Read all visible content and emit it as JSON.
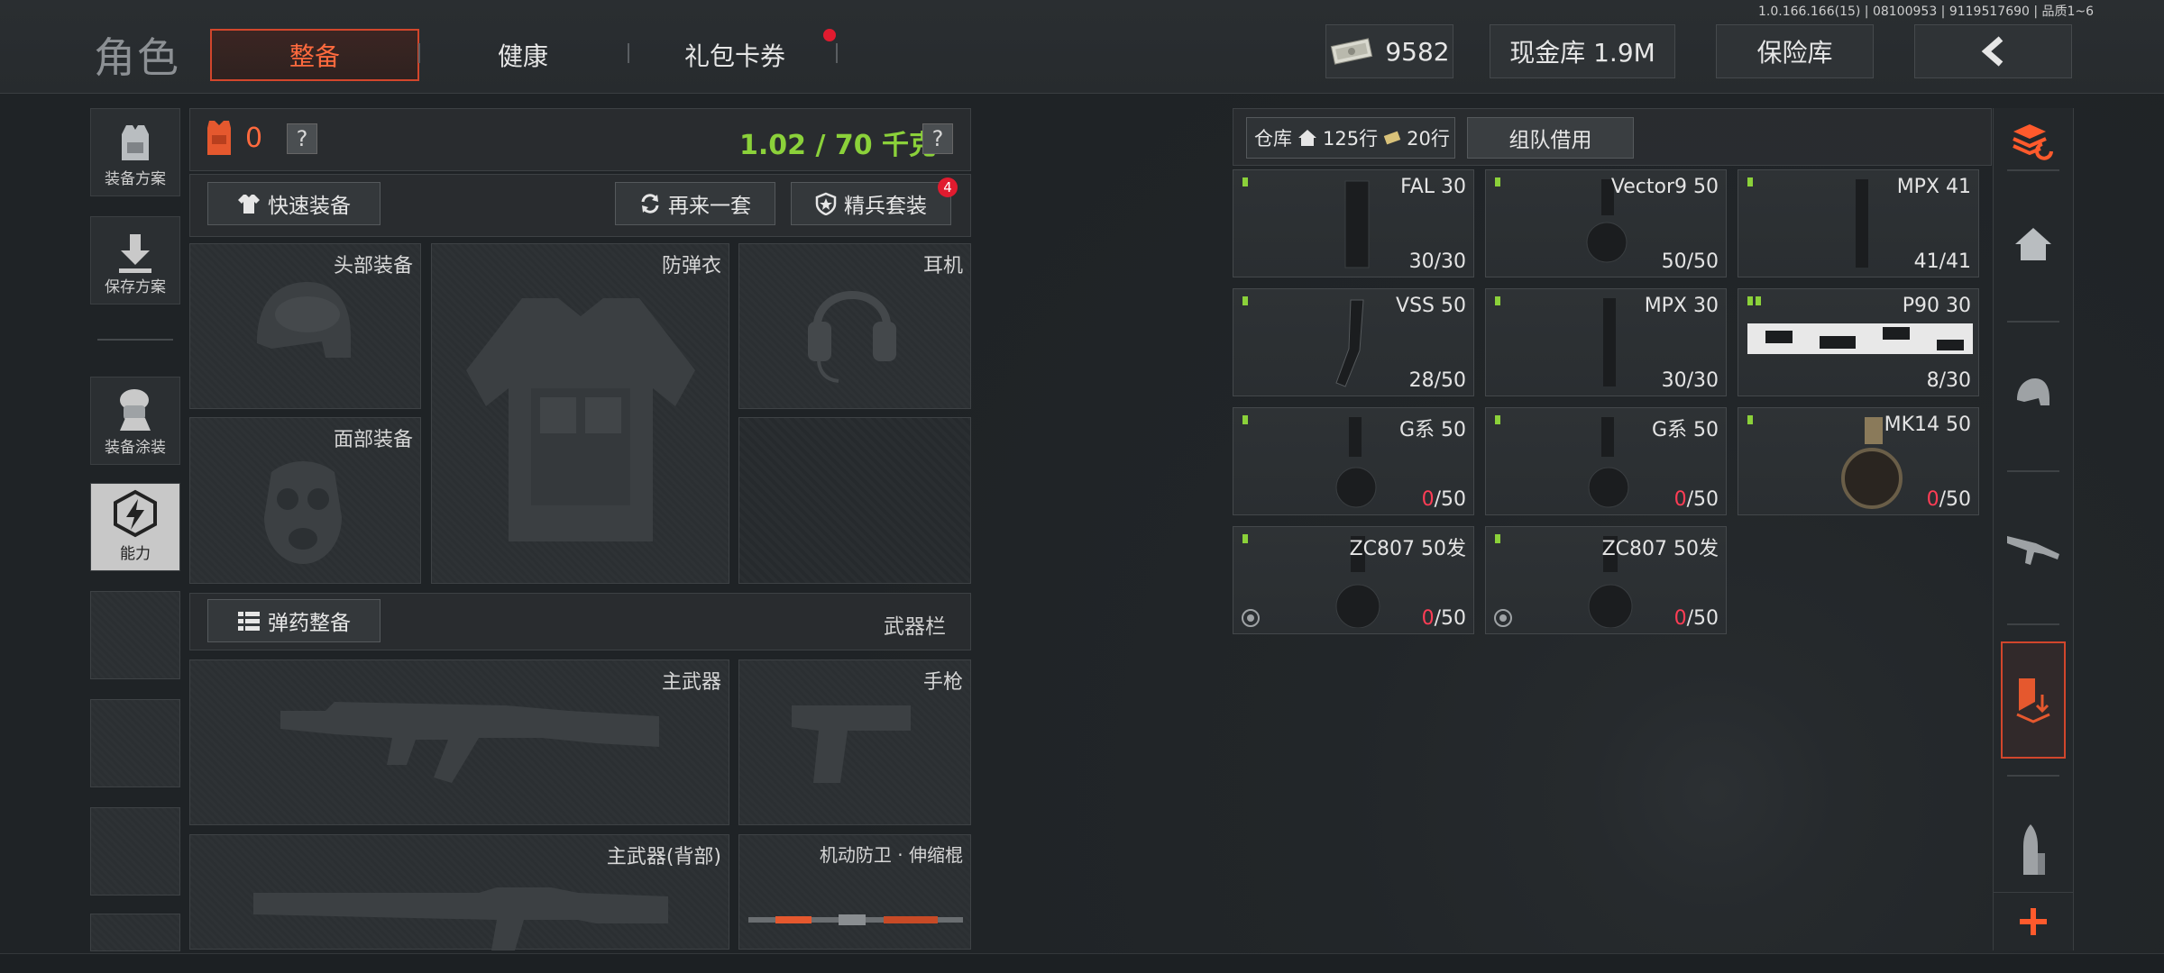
{
  "version_text": "1.0.166.166(15) | 08100953 | 9119517690 | 品质1~6",
  "header": {
    "title": "角色",
    "tabs": [
      {
        "label": "整备",
        "active": true
      },
      {
        "label": "健康",
        "active": false
      },
      {
        "label": "礼包卡券",
        "active": false,
        "has_notification": true
      }
    ],
    "currency": {
      "value": "9582",
      "icon": "banknote-icon"
    },
    "cash_vault_label": "现金库 1.9M",
    "insurance_vault_label": "保险库",
    "back_icon": "chevron-left-icon"
  },
  "left_sidebar": [
    {
      "label": "装备方案",
      "icon": "vest-icon"
    },
    {
      "label": "保存方案",
      "icon": "download-icon"
    },
    {
      "label": "装备涂装",
      "icon": "soldier-paint-icon"
    },
    {
      "label": "能力",
      "icon": "lightning-badge-icon",
      "active": true
    }
  ],
  "gear_panel": {
    "armor_count": "0",
    "weight": "1.02 / 70 千克",
    "help": "?",
    "quick_equip": "快速装备",
    "again_one_set": "再来一套",
    "elite_set": "精兵套装",
    "elite_badge": "4",
    "slots": {
      "head": "头部装备",
      "armor": "防弹衣",
      "headset": "耳机",
      "face": "面部装备"
    },
    "ammo_equip": "弹药整备",
    "weapon_bar": "武器栏",
    "weapon_slots": {
      "primary": "主武器",
      "pistol": "手枪",
      "primary_back": "主武器(背部)",
      "melee": "机动防卫 · 伸缩棍"
    }
  },
  "warehouse": {
    "tab_label": "仓库",
    "rows_home": "125行",
    "rows_ticket": "20行",
    "team_borrow": "组队借用",
    "items": [
      {
        "name": "FAL 30",
        "current": "30",
        "max": "/30",
        "empty": false,
        "marks": 1
      },
      {
        "name": "Vector9 50",
        "current": "50",
        "max": "/50",
        "empty": false,
        "marks": 1
      },
      {
        "name": "MPX 41",
        "current": "41",
        "max": "/41",
        "empty": false,
        "marks": 1
      },
      {
        "name": "VSS 50",
        "current": "28",
        "max": "/50",
        "empty": false,
        "marks": 1
      },
      {
        "name": "MPX 30",
        "current": "30",
        "max": "/30",
        "empty": false,
        "marks": 1
      },
      {
        "name": "P90 30",
        "current": "8",
        "max": "/30",
        "empty": false,
        "marks": 2
      },
      {
        "name": "G系 50",
        "current": "0",
        "max": "/50",
        "empty": true,
        "marks": 1
      },
      {
        "name": "G系 50",
        "current": "0",
        "max": "/50",
        "empty": true,
        "marks": 1
      },
      {
        "name": "MK14 50",
        "current": "0",
        "max": "/50",
        "empty": true,
        "marks": 1
      },
      {
        "name": "ZC807 50发",
        "current": "0",
        "max": "/50",
        "empty": true,
        "marks": 1,
        "badge": true
      },
      {
        "name": "ZC807 50发",
        "current": "0",
        "max": "/50",
        "empty": true,
        "marks": 1,
        "badge": true
      }
    ]
  },
  "right_sidebar": [
    "stack-refresh-icon",
    "home-icon",
    "helmet-icon",
    "rifle-icon",
    "ammo-unload-icon",
    "bullet-icon",
    "plus-icon"
  ],
  "colors": {
    "accent": "#ff6a3e",
    "weight_green": "#8bd13a",
    "empty_red": "#ff3d55"
  }
}
